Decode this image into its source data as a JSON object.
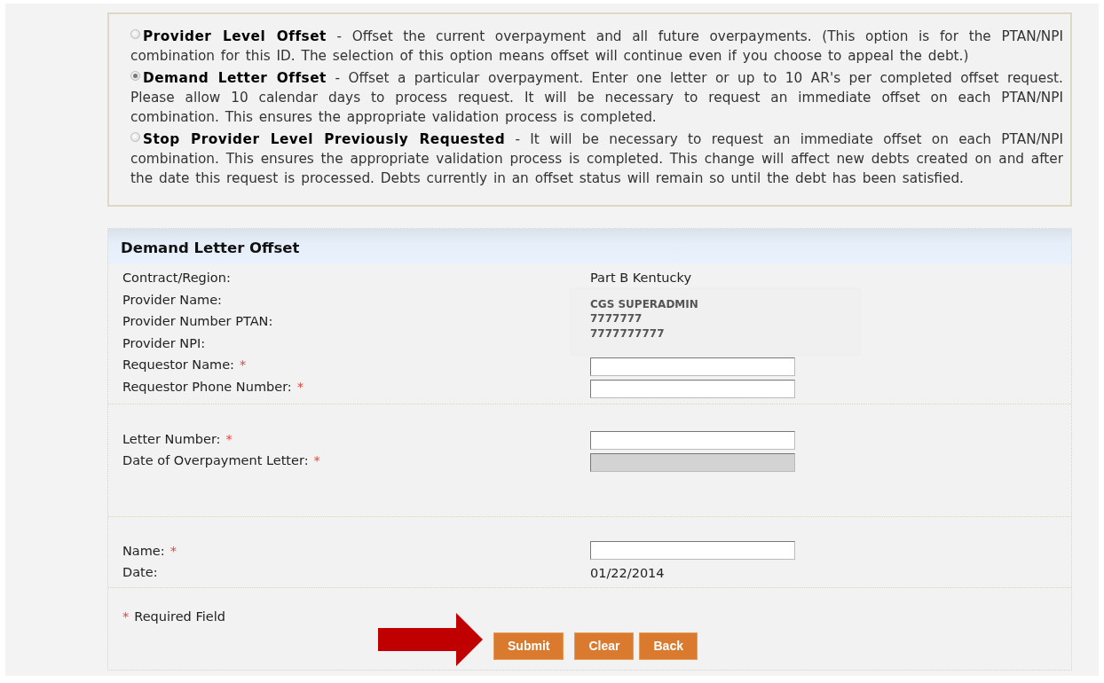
{
  "options": [
    {
      "title": "Provider Level Offset",
      "description": "- Offset the current overpayment and all future overpayments. (This option is for the PTAN/NPI combination for this ID. The selection of this option means offset will continue even if you choose to appeal the debt.)",
      "selected": false
    },
    {
      "title": "Demand Letter Offset",
      "description": "- Offset a particular overpayment. Enter one letter or up to 10 AR's per completed offset request. Please allow 10 calendar days to process request. It will be necessary to request an immediate offset on each PTAN/NPI combination. This ensures the appropriate validation process is completed.",
      "selected": true
    },
    {
      "title": "Stop Provider Level Previously Requested",
      "description": "- It will be necessary to request an immediate offset on each PTAN/NPI combination. This ensures the appropriate validation process is completed. This change will affect new debts created on and after the date this request is processed. Debts currently in an offset status will remain so until the debt has been satisfied.",
      "selected": false
    }
  ],
  "form": {
    "title": "Demand Letter Offset",
    "required_mark": "*",
    "sections": [
      {
        "labels": [
          {
            "text": "Contract/Region:",
            "required": false
          },
          {
            "text": "Provider Name:",
            "required": false
          },
          {
            "text": "Provider Number PTAN:",
            "required": false
          },
          {
            "text": "Provider NPI:",
            "required": false
          },
          {
            "text": "Requestor Name:",
            "required": true
          },
          {
            "text": "Requestor Phone Number:",
            "required": true
          }
        ],
        "entries": [
          {
            "kind": "value",
            "text": "Part B Kentucky"
          },
          {
            "kind": "info",
            "lines": [
              "CGS SUPERADMIN",
              "7777777",
              "7777777777"
            ]
          },
          {
            "kind": "input",
            "disabled": false
          },
          {
            "kind": "input",
            "disabled": false
          }
        ]
      },
      {
        "labels": [
          {
            "text": "Letter Number:",
            "required": true
          },
          {
            "text": "Date of Overpayment Letter:",
            "required": true
          }
        ],
        "entries": [
          {
            "kind": "input",
            "disabled": false
          },
          {
            "kind": "input",
            "disabled": true
          }
        ]
      },
      {
        "labels": [
          {
            "text": "Name:",
            "required": true
          },
          {
            "text": "Date:",
            "required": false
          }
        ],
        "entries": [
          {
            "kind": "input",
            "disabled": false
          },
          {
            "kind": "value",
            "text": "01/22/2014"
          }
        ]
      }
    ],
    "footnote": {
      "mark": "*",
      "text": "Required Field"
    },
    "buttons": [
      {
        "label": "Submit"
      },
      {
        "label": "Clear"
      },
      {
        "label": "Back"
      }
    ]
  }
}
